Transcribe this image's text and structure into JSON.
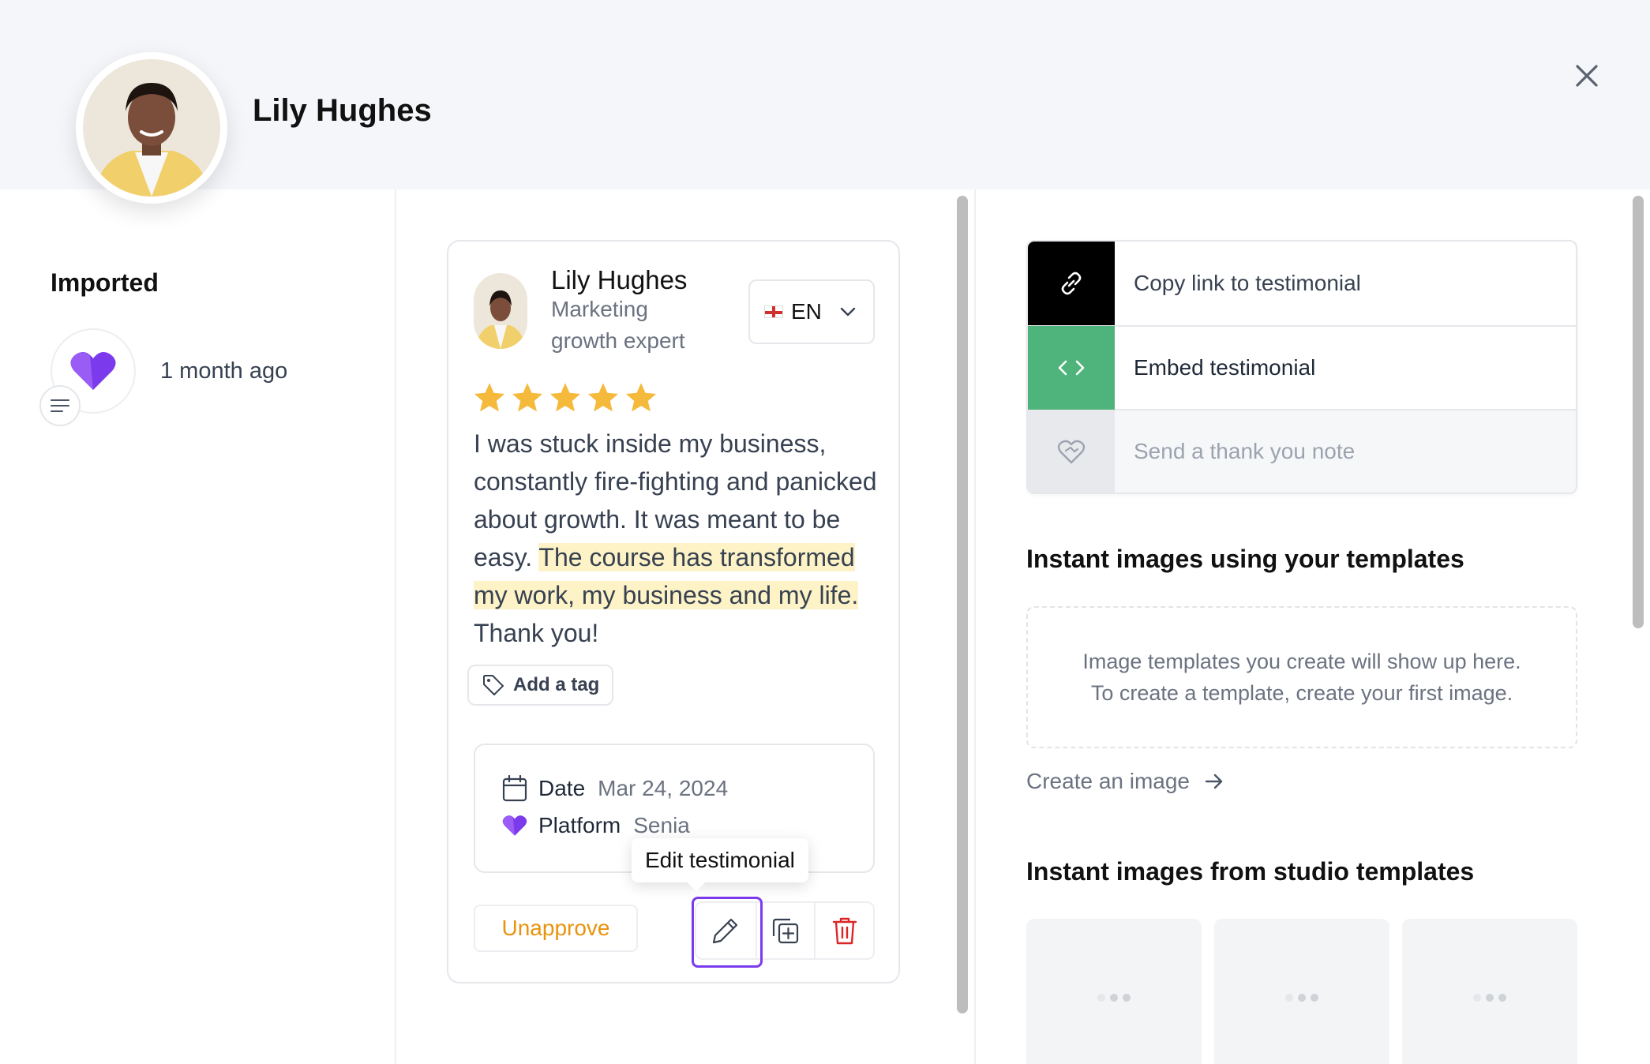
{
  "header": {
    "name": "Lily Hughes"
  },
  "source": {
    "label": "Imported",
    "time_ago": "1 month ago"
  },
  "testimonial": {
    "author_name": "Lily Hughes",
    "author_role": "Marketing growth expert",
    "language": "EN",
    "rating": 5,
    "text_before": "I was stuck inside my business, constantly fire-fighting and panicked about growth. It was meant to be easy. ",
    "text_highlight": "The course has transformed my work, my business and my life.",
    "text_after": " Thank you!",
    "add_tag_label": "Add a tag",
    "date_label": "Date",
    "date_value": "Mar 24, 2024",
    "platform_label": "Platform",
    "platform_value": "Senia",
    "unapprove_label": "Unapprove",
    "tooltip": "Edit testimonial"
  },
  "actions": {
    "copy_link": "Copy link to testimonial",
    "embed": "Embed testimonial",
    "thank_you": "Send a thank you note"
  },
  "templates_section": {
    "title": "Instant images using your templates",
    "empty_line1": "Image templates you create will show up here.",
    "empty_line2": "To create a template, create your first image.",
    "create_link": "Create an image"
  },
  "studio_section": {
    "title": "Instant images from studio templates"
  },
  "colors": {
    "accent_purple": "#7c3aed",
    "star_yellow": "#f5b93b",
    "embed_green": "#4fb47b",
    "highlight": "#fdf3c6",
    "unapprove_orange": "#e8930c",
    "delete_red": "#dc2626"
  },
  "icons": [
    "close-icon",
    "heart-logo-icon",
    "notes-icon",
    "globe-flag-icon",
    "chevron-down-icon",
    "star-icon",
    "tag-icon",
    "calendar-icon",
    "pencil-icon",
    "duplicate-icon",
    "trash-icon",
    "link-icon",
    "code-icon",
    "heart-hand-icon",
    "arrow-right-icon"
  ]
}
